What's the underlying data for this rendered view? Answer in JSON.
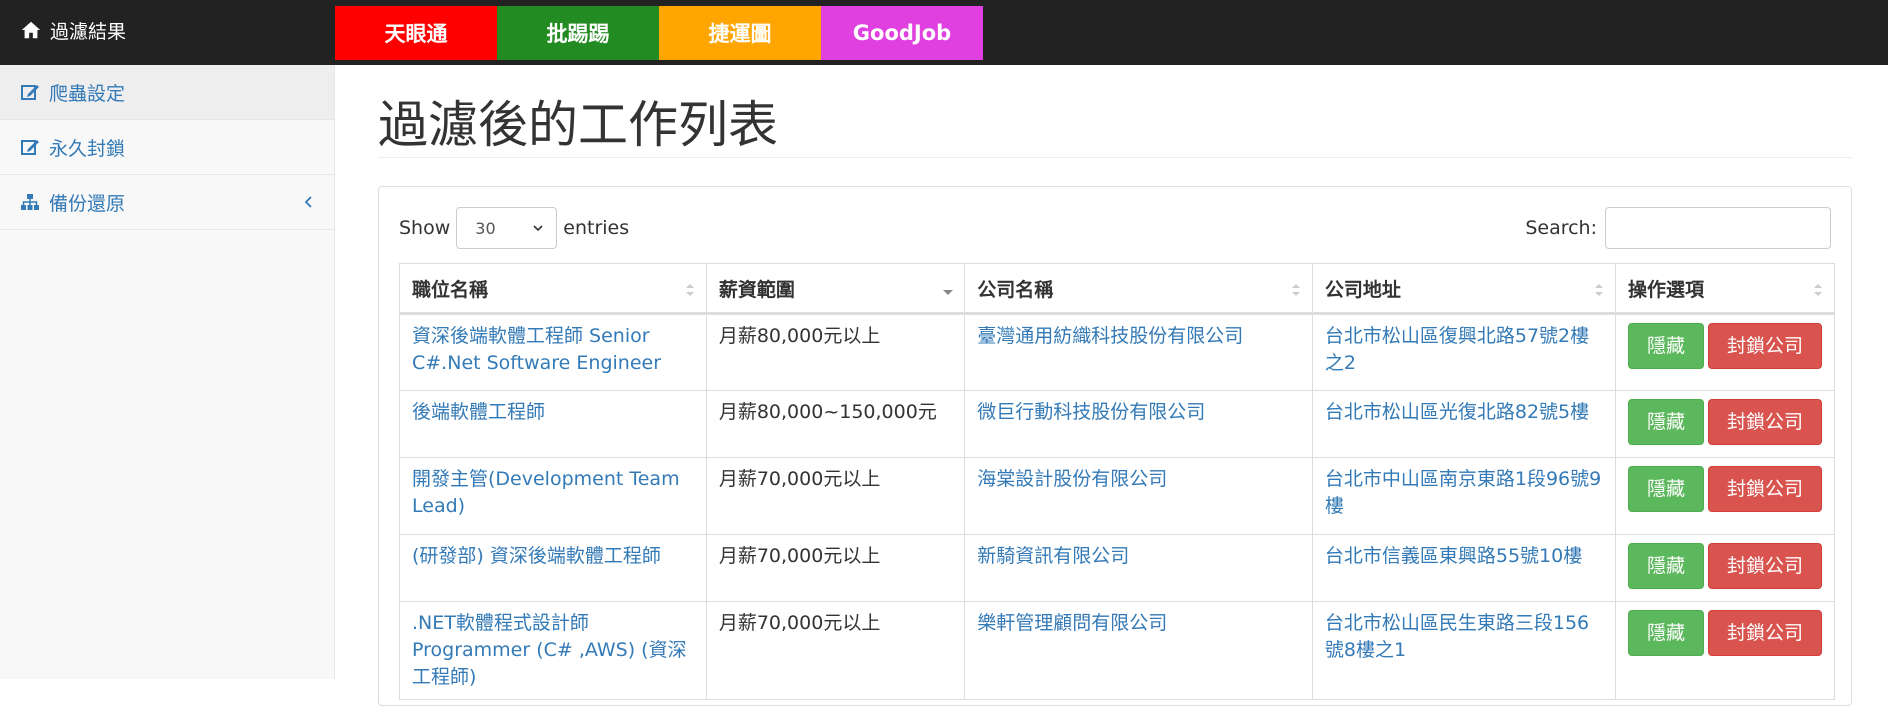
{
  "navbar": {
    "brand_label": "過濾結果",
    "sites": [
      {
        "label": "天眼通",
        "color": "#ff0000"
      },
      {
        "label": "批踢踢",
        "color": "#228b22"
      },
      {
        "label": "捷運圖",
        "color": "#ffa500"
      },
      {
        "label": "GoodJob",
        "color": "#e040e0"
      }
    ]
  },
  "sidebar": {
    "items": [
      {
        "label": "爬蟲設定",
        "icon": "edit-icon"
      },
      {
        "label": "永久封鎖",
        "icon": "edit-icon"
      },
      {
        "label": "備份還原",
        "icon": "sitemap-icon"
      }
    ]
  },
  "main": {
    "title": "過濾後的工作列表",
    "show_label": "Show",
    "entries_label": "entries",
    "page_length": "30",
    "search_label": "Search:",
    "search_value": ""
  },
  "table": {
    "columns": [
      "職位名稱",
      "薪資範圍",
      "公司名稱",
      "公司地址",
      "操作選項"
    ],
    "hide_label": "隱藏",
    "block_label": "封鎖公司",
    "rows": [
      {
        "title": "資深後端軟體工程師 Senior C#.Net Software Engineer",
        "salary": "月薪80,000元以上",
        "company": "臺灣通用紡織科技股份有限公司",
        "address": "台北市松山區復興北路57號2樓之2"
      },
      {
        "title": "後端軟體工程師",
        "salary": "月薪80,000~150,000元",
        "company": "微巨行動科技股份有限公司",
        "address": "台北市松山區光復北路82號5樓"
      },
      {
        "title": "開發主管(Development Team Lead)",
        "salary": "月薪70,000元以上",
        "company": "海棠設計股份有限公司",
        "address": "台北市中山區南京東路1段96號9樓"
      },
      {
        "title": "(研發部) 資深後端軟體工程師",
        "salary": "月薪70,000元以上",
        "company": "新騎資訊有限公司",
        "address": "台北市信義區東興路55號10樓"
      },
      {
        "title": ".NET軟體程式設計師 Programmer (C# ,AWS) (資深工程師)",
        "salary": "月薪70,000元以上",
        "company": "樂軒管理顧問有限公司",
        "address": "台北市松山區民生東路三段156號8樓之1"
      }
    ]
  }
}
